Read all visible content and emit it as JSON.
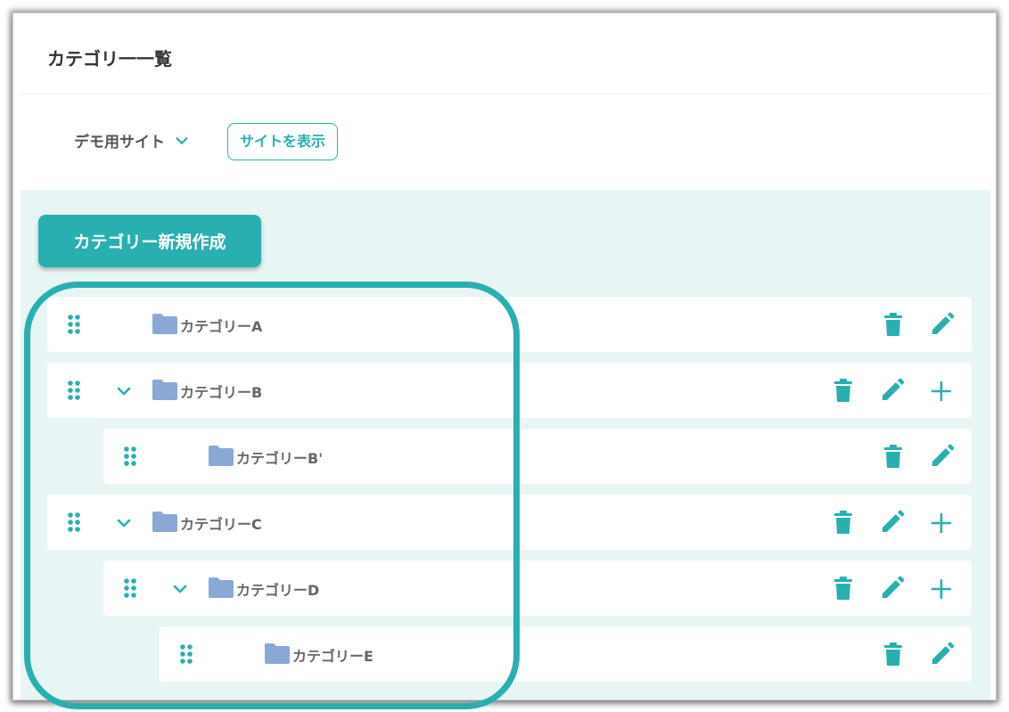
{
  "page": {
    "title": "カテゴリ一一覧"
  },
  "site": {
    "selected": "デモ用サイト",
    "view_button": "サイトを表示"
  },
  "toolbar": {
    "new_category": "カテゴリー新規作成"
  },
  "categories": [
    {
      "label": "カテゴリーA",
      "level": 0,
      "expandable": false,
      "can_add_child": false
    },
    {
      "label": "カテゴリーB",
      "level": 0,
      "expandable": true,
      "can_add_child": true
    },
    {
      "label": "カテゴリーB'",
      "level": 1,
      "expandable": false,
      "can_add_child": false
    },
    {
      "label": "カテゴリーC",
      "level": 0,
      "expandable": true,
      "can_add_child": true
    },
    {
      "label": "カテゴリーD",
      "level": 1,
      "expandable": true,
      "can_add_child": true
    },
    {
      "label": "カテゴリーE",
      "level": 2,
      "expandable": false,
      "can_add_child": false
    }
  ],
  "icons": {
    "drag": "drag-handle-icon",
    "expand": "chevron-down-icon",
    "folder": "folder-icon",
    "delete": "trash-icon",
    "edit": "pencil-icon",
    "add": "plus-icon"
  },
  "colors": {
    "accent": "#2aafb0",
    "content_background": "#e7f5f5",
    "folder": "#8aa8d6",
    "highlight": "#2aafb0"
  }
}
